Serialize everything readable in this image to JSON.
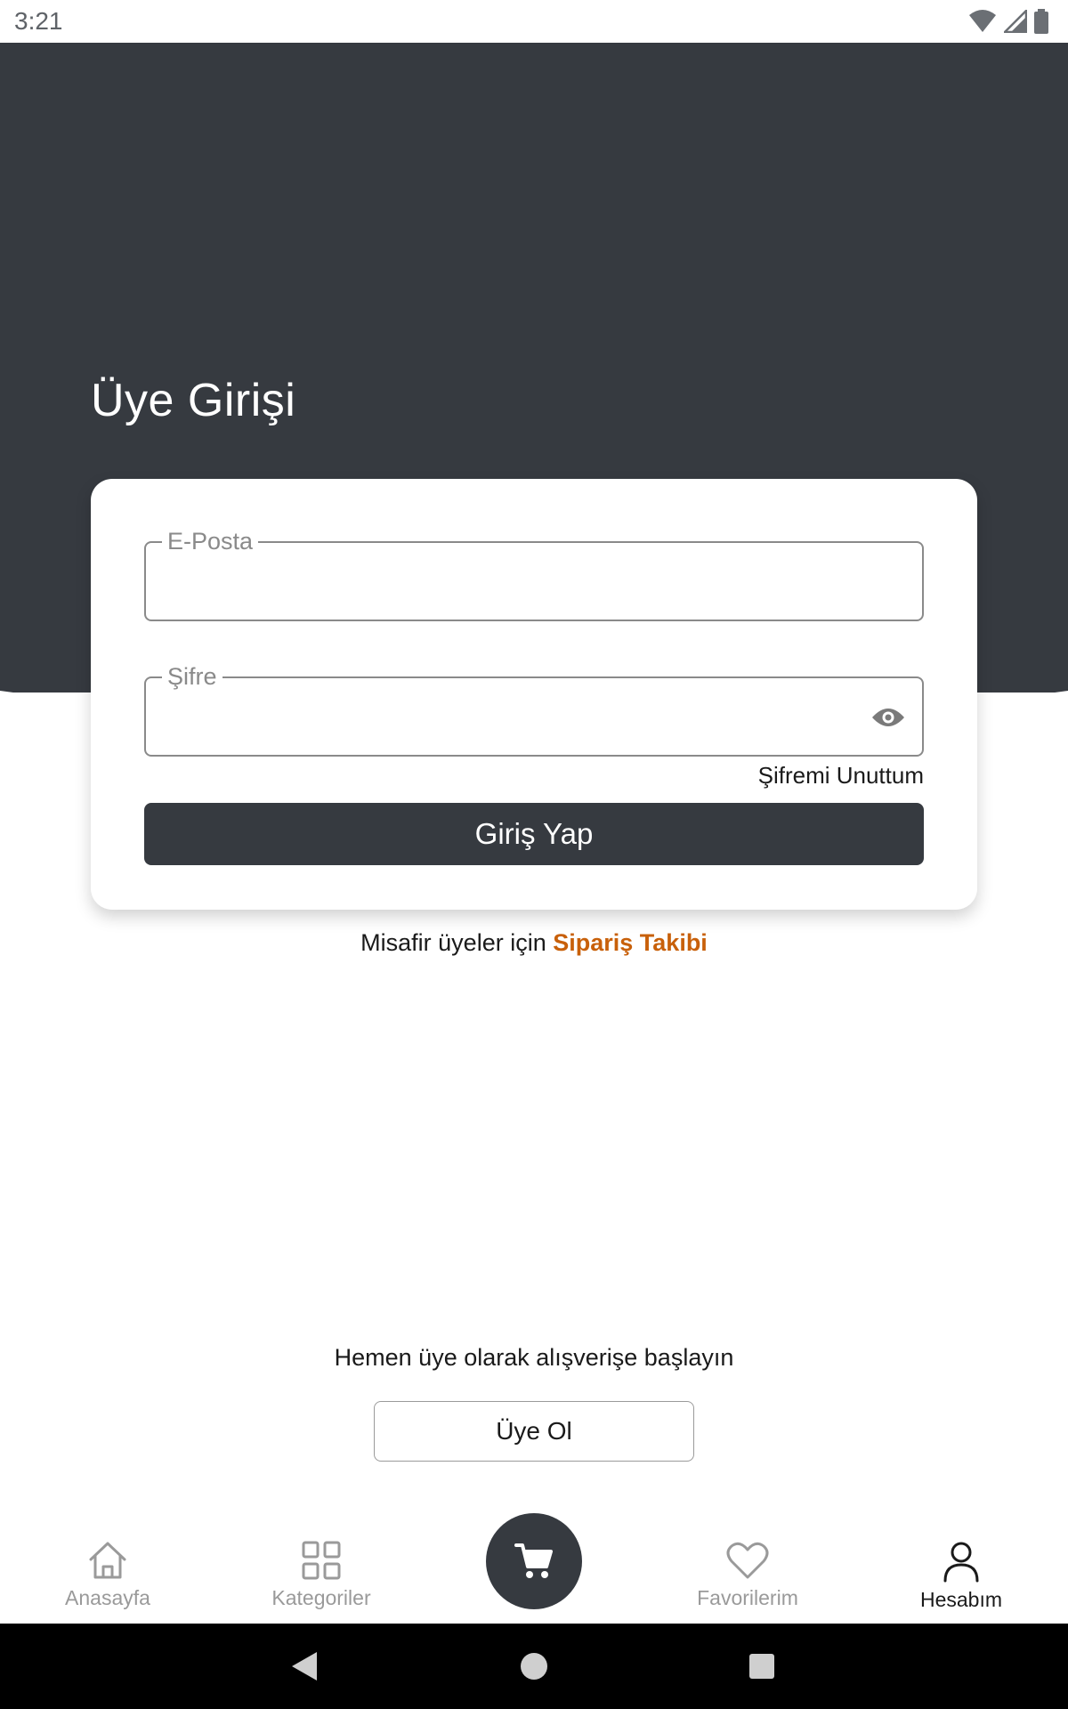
{
  "status_bar": {
    "time": "3:21",
    "icons": [
      "wifi-icon",
      "cell-signal-icon",
      "battery-icon"
    ]
  },
  "header": {
    "title": "Üye Girişi"
  },
  "login_form": {
    "email_label": "E-Posta",
    "email_value": "",
    "password_label": "Şifre",
    "password_value": "",
    "forgot_password": "Şifremi Unuttum",
    "submit_label": "Giriş Yap"
  },
  "guest": {
    "prefix": "Misafir üyeler için",
    "link": "Sipariş Takibi"
  },
  "register": {
    "promo": "Hemen üye olarak alışverişe başlayın",
    "button_label": "Üye Ol"
  },
  "bottom_nav": {
    "items": [
      {
        "label": "Anasayfa",
        "icon": "home-icon",
        "active": false
      },
      {
        "label": "Kategoriler",
        "icon": "grid-icon",
        "active": false
      },
      {
        "label": "",
        "icon": "cart-icon",
        "active": false
      },
      {
        "label": "Favorilerim",
        "icon": "heart-icon",
        "active": false
      },
      {
        "label": "Hesabım",
        "icon": "user-icon",
        "active": true
      }
    ]
  },
  "colors": {
    "header_bg": "#363a40",
    "accent_link": "#c8600a",
    "primary_button": "#363a40"
  },
  "system_nav": {
    "icons": [
      "back-icon",
      "home-circle-icon",
      "recents-icon"
    ]
  }
}
